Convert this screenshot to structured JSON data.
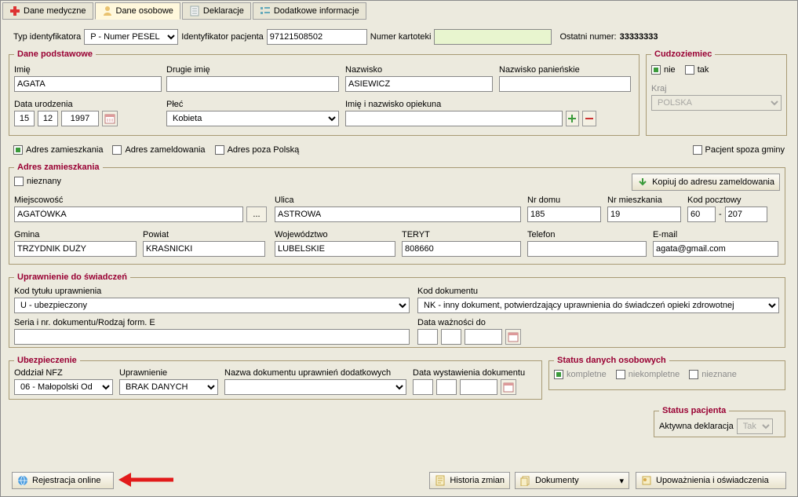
{
  "tabs": {
    "t1": "Dane medyczne",
    "t2": "Dane osobowe",
    "t3": "Deklaracje",
    "t4": "Dodatkowe informacje"
  },
  "topRow": {
    "typLabel": "Typ identyfikatora",
    "typValue": "P - Numer PESEL",
    "idLabel": "Identyfikator pacjenta",
    "idValue": "97121508502",
    "kartLabel": "Numer kartoteki",
    "kartValue": "",
    "lastLabel": "Ostatni numer:",
    "lastValue": "33333333"
  },
  "podst": {
    "legend": "Dane podstawowe",
    "imieL": "Imię",
    "imie": "AGATA",
    "drugieL": "Drugie imię",
    "drugie": "",
    "nazwL": "Nazwisko",
    "nazw": "ASIEWICZ",
    "panL": "Nazwisko panieńskie",
    "pan": "",
    "dataL": "Data urodzenia",
    "d": "15",
    "m": "12",
    "r": "1997",
    "plecL": "Płeć",
    "plec": "Kobieta",
    "opiekL": "Imię i nazwisko opiekuna",
    "opiek": ""
  },
  "cudzo": {
    "legend": "Cudzoziemiec",
    "nie": "nie",
    "tak": "tak",
    "krajL": "Kraj",
    "kraj": "POLSKA"
  },
  "adrBar": {
    "zam": "Adres zamieszkania",
    "zamel": "Adres zameldowania",
    "poza": "Adres poza Polską",
    "spoza": "Pacjent spoza gminy"
  },
  "adres": {
    "legend": "Adres zamieszkania",
    "niez": "nieznany",
    "kopiuj": "Kopiuj do adresu zameldowania",
    "miejL": "Miejscowość",
    "miej": "AGATÓWKA",
    "ulL": "Ulica",
    "ul": "ASTROWA",
    "nrdL": "Nr domu",
    "nrd": "185",
    "nrmL": "Nr mieszkania",
    "nrm": "19",
    "kodL": "Kod pocztowy",
    "kod1": "60",
    "kod2": "207",
    "gmL": "Gmina",
    "gm": "TRZYDNIK DUŻY",
    "powL": "Powiat",
    "pow": "KRAŚNICKI",
    "wojL": "Województwo",
    "woj": "LUBELSKIE",
    "terL": "TERYT",
    "ter": "808660",
    "telL": "Telefon",
    "tel": "",
    "emailL": "E-mail",
    "email": "agata@gmail.com"
  },
  "upraw": {
    "legend": "Uprawnienie do świadczeń",
    "kodTytL": "Kod tytułu uprawnienia",
    "kodTyt": "U - ubezpieczony",
    "kodDokL": "Kod dokumentu",
    "kodDok": "NK - inny dokument, potwierdzający uprawnienia do świadczeń opieki zdrowotnej",
    "seriaL": "Seria i nr. dokumentu/Rodzaj form. E",
    "seria": "",
    "dataWL": "Data ważności do",
    "dataW": ""
  },
  "ubez": {
    "legend": "Ubezpieczenie",
    "oddL": "Oddział NFZ",
    "odd": "06 - Małopolski Od",
    "uprL": "Uprawnienie",
    "upr": "BRAK DANYCH",
    "nazwL": "Nazwa dokumentu uprawnień dodatkowych",
    "nazw": "",
    "dataL": "Data wystawienia dokumentu",
    "d": "",
    "m": "",
    "r": ""
  },
  "status": {
    "legend": "Status danych osobowych",
    "komp": "kompletne",
    "niek": "niekompletne",
    "niez": "nieznane"
  },
  "statPac": {
    "legend": "Status pacjenta",
    "aktL": "Aktywna deklaracja",
    "akt": "Tak"
  },
  "bottom": {
    "rej": "Rejestracja online",
    "hist": "Historia zmian",
    "dok": "Dokumenty",
    "upow": "Upoważnienia i oświadczenia"
  }
}
